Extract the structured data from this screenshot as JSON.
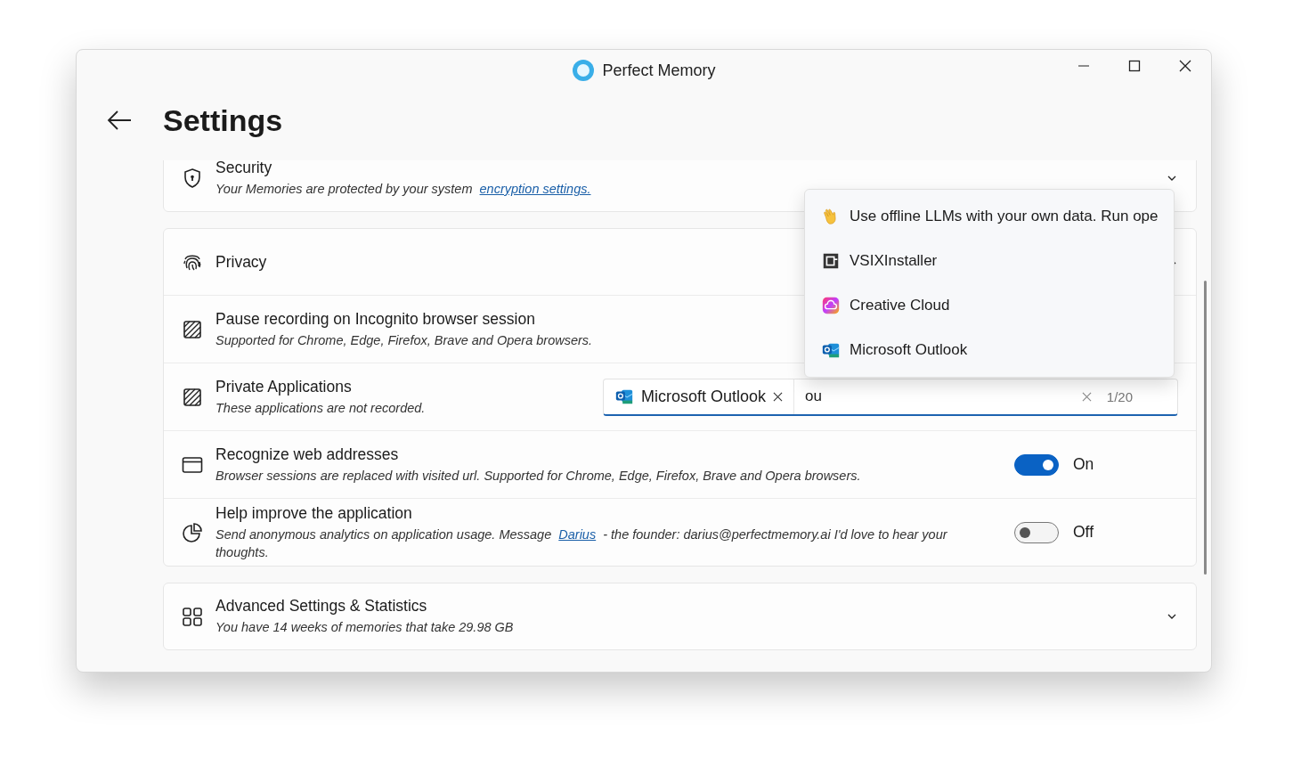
{
  "window": {
    "title": "Perfect Memory"
  },
  "page": {
    "title": "Settings"
  },
  "sections": [
    {
      "kind": "simple",
      "title": "Security",
      "expanded": false,
      "description": [
        {
          "text": "Your Memories are protected by your system "
        },
        {
          "link": "encryption settings."
        }
      ]
    },
    {
      "kind": "group",
      "title": "Privacy",
      "expanded": true,
      "rows": [
        {
          "kind": "plain",
          "title": "Pause recording on Incognito browser session",
          "description": [
            {
              "text": "Supported for Chrome, Edge, Firefox, Brave and Opera browsers."
            }
          ]
        },
        {
          "kind": "apps",
          "title": "Private Applications",
          "description": [
            {
              "text": "These applications are not recorded."
            }
          ],
          "field": {
            "chips": [
              "Microsoft Outlook"
            ],
            "value": "ou",
            "count": "1/20"
          }
        },
        {
          "kind": "toggle",
          "title": "Recognize web addresses",
          "description": [
            {
              "text": "Browser sessions are replaced with visited url. Supported for Chrome, Edge, Firefox, Brave and Opera browsers."
            }
          ],
          "on": true,
          "state_label": "On"
        },
        {
          "kind": "toggle",
          "title": "Help improve the application",
          "description": [
            {
              "text": "Send anonymous analytics on application usage.  Message "
            },
            {
              "link": "Darius"
            },
            {
              "text": "  - the founder: darius@perfectmemory.ai  I'd love to hear your thoughts."
            }
          ],
          "on": false,
          "state_label": "Off"
        }
      ]
    },
    {
      "kind": "simple",
      "title": "Advanced Settings & Statistics",
      "expanded": false,
      "description": [
        {
          "text": "You have 14 weeks of memories that take 29.98 GB"
        }
      ]
    }
  ],
  "suggestions": [
    {
      "label": "Use offline LLMs with your own data. Run ope"
    },
    {
      "label": "VSIXInstaller"
    },
    {
      "label": "Creative Cloud"
    },
    {
      "label": "Microsoft Outlook"
    }
  ]
}
